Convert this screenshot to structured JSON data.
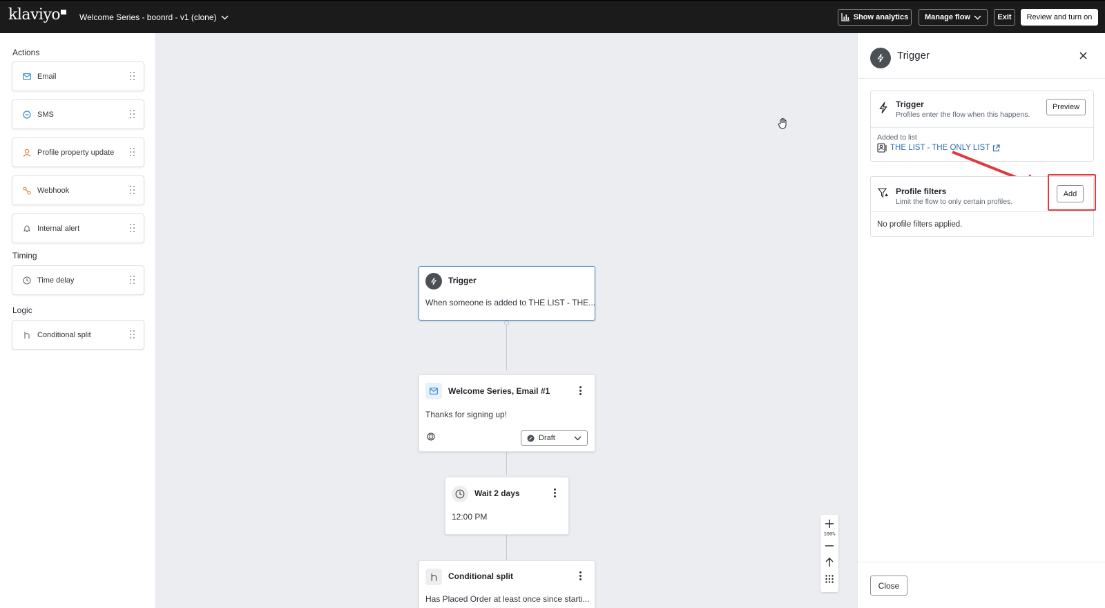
{
  "topbar": {
    "logo": "klaviyo",
    "flow_name": "Welcome Series - boonrd - v1 (clone)",
    "show_analytics": "Show analytics",
    "manage_flow": "Manage flow",
    "exit": "Exit",
    "review": "Review and turn on"
  },
  "sidebar": {
    "actions_heading": "Actions",
    "timing_heading": "Timing",
    "logic_heading": "Logic",
    "actions": [
      {
        "label": "Email",
        "icon": "email-icon",
        "color": "#2d8bd6"
      },
      {
        "label": "SMS",
        "icon": "sms-icon",
        "color": "#2d8bd6"
      },
      {
        "label": "Profile property update",
        "icon": "profile-icon",
        "color": "#e07a2e"
      },
      {
        "label": "Webhook",
        "icon": "webhook-icon",
        "color": "#e07a2e"
      },
      {
        "label": "Internal alert",
        "icon": "bell-icon",
        "color": "#666666"
      }
    ],
    "timing": [
      {
        "label": "Time delay",
        "icon": "clock-icon",
        "color": "#666666"
      }
    ],
    "logic": [
      {
        "label": "Conditional split",
        "icon": "split-icon",
        "color": "#666666"
      }
    ]
  },
  "canvas": {
    "trigger_node": {
      "title": "Trigger",
      "body": "When someone is added to THE LIST - THE..."
    },
    "email_node": {
      "title": "Welcome Series, Email #1",
      "body": "Thanks for signing up!",
      "status": "Draft"
    },
    "wait_node": {
      "title": "Wait 2 days",
      "body": "12:00 PM"
    },
    "split_node": {
      "title": "Conditional split",
      "body": "Has Placed Order at least once since starti..."
    },
    "zoom": {
      "level": "100%"
    }
  },
  "panel": {
    "title": "Trigger",
    "trigger_card": {
      "title": "Trigger",
      "subtitle": "Profiles enter the flow when this happens.",
      "preview": "Preview",
      "added_label": "Added to list",
      "list_name": "THE LIST - THE ONLY LIST"
    },
    "filters_card": {
      "title": "Profile filters",
      "subtitle": "Limit the flow to only certain profiles.",
      "add": "Add",
      "empty": "No profile filters applied."
    },
    "close": "Close"
  },
  "colors": {
    "topbar_bg": "#1b1b1b",
    "canvas_bg": "#ebedf0",
    "selected_border": "#3b82c4",
    "link": "#2b6cb0",
    "annotation": "#e03a3e"
  }
}
